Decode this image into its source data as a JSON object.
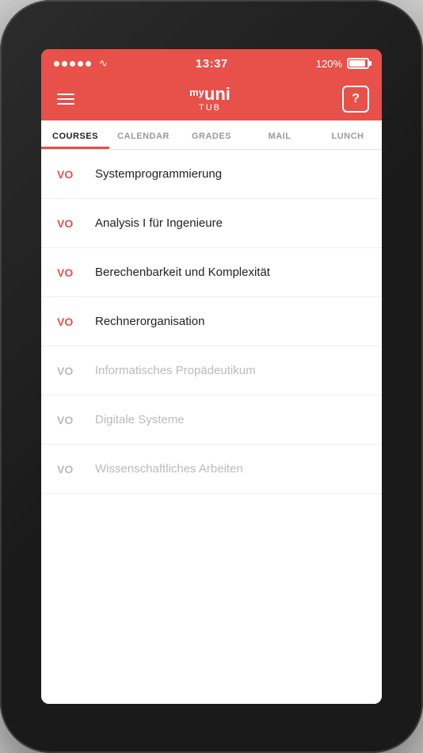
{
  "status_bar": {
    "time": "13:37",
    "battery_percent": "120%",
    "signal_dots": 5
  },
  "header": {
    "logo_my": "my",
    "logo_uni": "uni",
    "logo_sub": "TUB",
    "menu_icon": "≡",
    "help_label": "?"
  },
  "tabs": [
    {
      "id": "courses",
      "label": "COURSES",
      "active": true
    },
    {
      "id": "calendar",
      "label": "CALENDAR",
      "active": false
    },
    {
      "id": "grades",
      "label": "GRADES",
      "active": false
    },
    {
      "id": "mail",
      "label": "MAIL",
      "active": false
    },
    {
      "id": "lunch",
      "label": "LUNCH",
      "active": false
    }
  ],
  "courses": [
    {
      "tag": "VO",
      "name": "Systemprogrammierung",
      "active": true
    },
    {
      "tag": "VO",
      "name": "Analysis I für Ingenieure",
      "active": true
    },
    {
      "tag": "VO",
      "name": "Berechenbarkeit und Komplexität",
      "active": true
    },
    {
      "tag": "VO",
      "name": "Rechnerorganisation",
      "active": true
    },
    {
      "tag": "VO",
      "name": "Informatisches Propädeutikum",
      "active": false
    },
    {
      "tag": "VO",
      "name": "Digitale Systeme",
      "active": false
    },
    {
      "tag": "VO",
      "name": "Wissenschaftliches Arbeiten",
      "active": false
    }
  ]
}
